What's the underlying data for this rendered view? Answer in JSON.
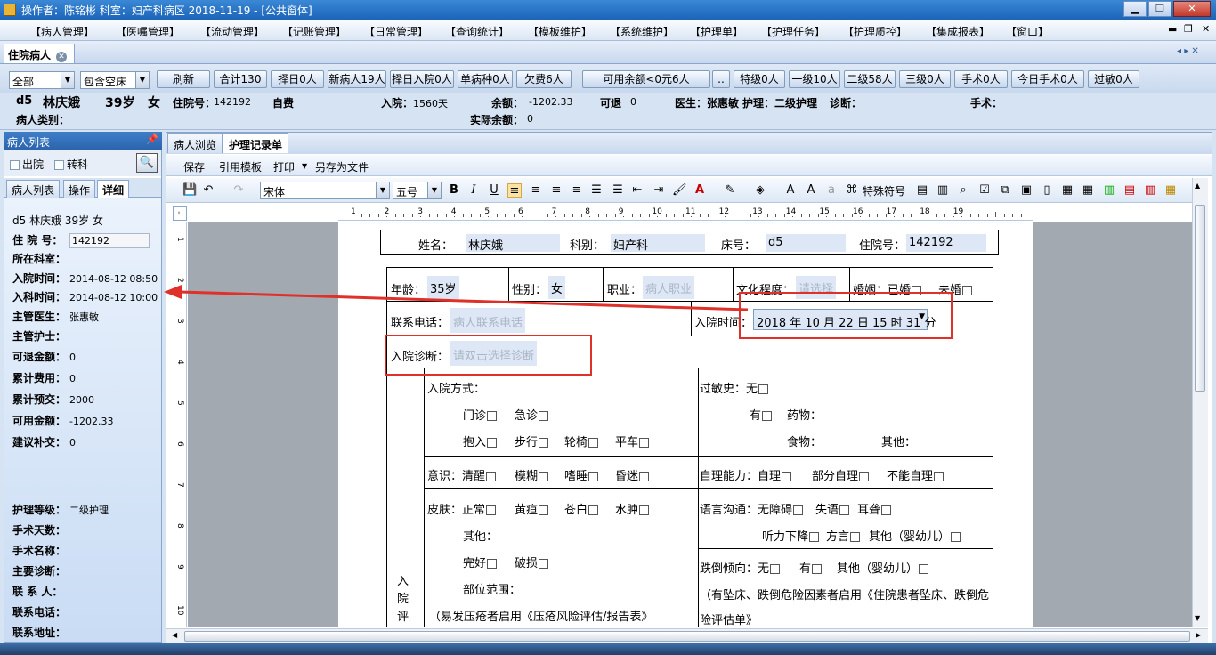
{
  "titlebar": {
    "text": "操作者：陈铭彬  科室：妇产科病区  2018-11-19 - [公共窗体]"
  },
  "menu": [
    "【病人管理】",
    "【医嘱管理】",
    "【流动管理】",
    "【记账管理】",
    "【日常管理】",
    "【查询统计】",
    "【模板维护】",
    "【系统维护】",
    "【护理单】",
    "【护理任务】",
    "【护理质控】",
    "【集成报表】",
    "【窗口】"
  ],
  "doc_tab": {
    "label": "住院病人"
  },
  "filter": {
    "select1": "全部",
    "select2": "包含空床",
    "buttons": [
      "刷新",
      "合计130",
      "择日0人",
      "新病人19人",
      "择日入院0人",
      "单病种0人",
      "欠费6人",
      "可用余额<0元6人",
      "..",
      "特级0人",
      "一级10人",
      "二级58人",
      "三级0人",
      "手术0人",
      "今日手术0人",
      "过敏0人"
    ]
  },
  "patient_info": {
    "bed": "d5",
    "name": "林庆娥",
    "age": "39岁",
    "sex": "女",
    "admission_no_label": "住院号：",
    "admission_no": "142192",
    "pay_type": "自费",
    "admit_label": "入院：",
    "admit_days": "1560天",
    "balance_label": "余额：",
    "balance": "-1202.33",
    "refund_label": "可退",
    "refund": "0",
    "doctor": "医生：张惠敏",
    "nursing": "护理：二级护理",
    "diagnosis_label": "诊断：",
    "surgery_label": "手术：",
    "category_label": "病人类别：",
    "actual_balance_label": "实际余额：",
    "actual_balance": "0"
  },
  "left_panel": {
    "title": "病人列表",
    "check_discharged": "出院",
    "check_transfer": "转科",
    "tabs": [
      "病人列表",
      "操作",
      "详细"
    ],
    "header": "d5   林庆娥    39岁   女",
    "rows": [
      {
        "k": "住 院 号：",
        "v": "142192"
      },
      {
        "k": "所在科室：",
        "v": ""
      },
      {
        "k": "入院时间：",
        "v": "2014-08-12 08:50"
      },
      {
        "k": "入科时间：",
        "v": "2014-08-12 10:00"
      },
      {
        "k": "主管医生：",
        "v": "张惠敏"
      },
      {
        "k": "主管护士：",
        "v": ""
      },
      {
        "k": "可退金额：",
        "v": "0"
      },
      {
        "k": "累计费用：",
        "v": "0"
      },
      {
        "k": "累计预交：",
        "v": "2000"
      },
      {
        "k": "可用金额：",
        "v": "-1202.33"
      },
      {
        "k": "建议补交：",
        "v": "0"
      }
    ],
    "rows2": [
      {
        "k": "护理等级：",
        "v": "二级护理"
      },
      {
        "k": "手术天数：",
        "v": ""
      },
      {
        "k": "手术名称：",
        "v": ""
      },
      {
        "k": "主要诊断：",
        "v": ""
      },
      {
        "k": "联 系 人：",
        "v": ""
      },
      {
        "k": "联系电话：",
        "v": ""
      },
      {
        "k": "联系地址：",
        "v": ""
      }
    ]
  },
  "right_tabs": [
    "病人浏览",
    "护理记录单"
  ],
  "actions": [
    "保存",
    "引用模板",
    "打印",
    "另存为文件"
  ],
  "format": {
    "font": "宋体",
    "size": "五号",
    "special_chars": "特殊符号"
  },
  "ruler": [
    "1",
    "2",
    "3",
    "4",
    "5",
    "6",
    "7",
    "8",
    "9",
    "10",
    "11",
    "12",
    "13",
    "14",
    "15",
    "16",
    "17",
    "18",
    "19"
  ],
  "doc": {
    "name_label": "姓名：",
    "name": "林庆娥",
    "dept_label": "科别：",
    "dept": "妇产科",
    "bed_label": "床号：",
    "bed": "d5",
    "adm_label": "住院号：",
    "adm": "142192",
    "age_label": "年龄：",
    "age": "35岁",
    "sex_label": "性别：",
    "sex": "女",
    "job_label": "职业：",
    "job_ph": "病人职业",
    "edu_label": "文化程度：",
    "edu_ph": "请选择",
    "marriage_label": "婚姻：已婚",
    "unmarried": "未婚",
    "phone_label": "联系电话：",
    "phone_ph": "病人联系电话",
    "admit_time_label": "入院时间：",
    "admit_time": "2018 年 10 月 22 日 15 时 31 分",
    "diag_label": "入院诊断：",
    "diag_ph": "请双击选择诊断",
    "way_label": "入院方式：",
    "way1": [
      "门诊",
      "急诊"
    ],
    "way2": [
      "抱入",
      "步行",
      "轮椅",
      "平车"
    ],
    "allergy": "过敏史：无",
    "allergy_yes": "有",
    "drug": "药物：",
    "food": "食物：",
    "other": "其他：",
    "consc": "意识：清醒",
    "consc_opts": [
      "模糊",
      "嗜睡",
      "昏迷"
    ],
    "self": "自理能力：自理",
    "self_opts": [
      "部分自理",
      "不能自理"
    ],
    "skin": "皮肤：正常",
    "skin_opts": [
      "黄疸",
      "苍白",
      "水肿"
    ],
    "skin_other": "其他：",
    "skin_ok": "完好",
    "skin_bad": "破损",
    "range": "部位范围：",
    "pressure_note": "（易发压疮者启用《压疮风险评估/报告表》",
    "lang": "语言沟通：无障碍",
    "lang_opts": [
      "失语",
      "耳聋"
    ],
    "lang2": "听力下降",
    "lang2_opts": [
      "方言",
      "其他（婴幼儿）"
    ],
    "fall": "跌倒倾向：无",
    "fall_yes": "有",
    "fall_other": "其他（婴幼儿）",
    "fall_note1": "（有坠床、跌倒危险因素者启用《住院患者坠床、跌倒危",
    "fall_note2": "险评估单》",
    "vert": "入院评"
  }
}
